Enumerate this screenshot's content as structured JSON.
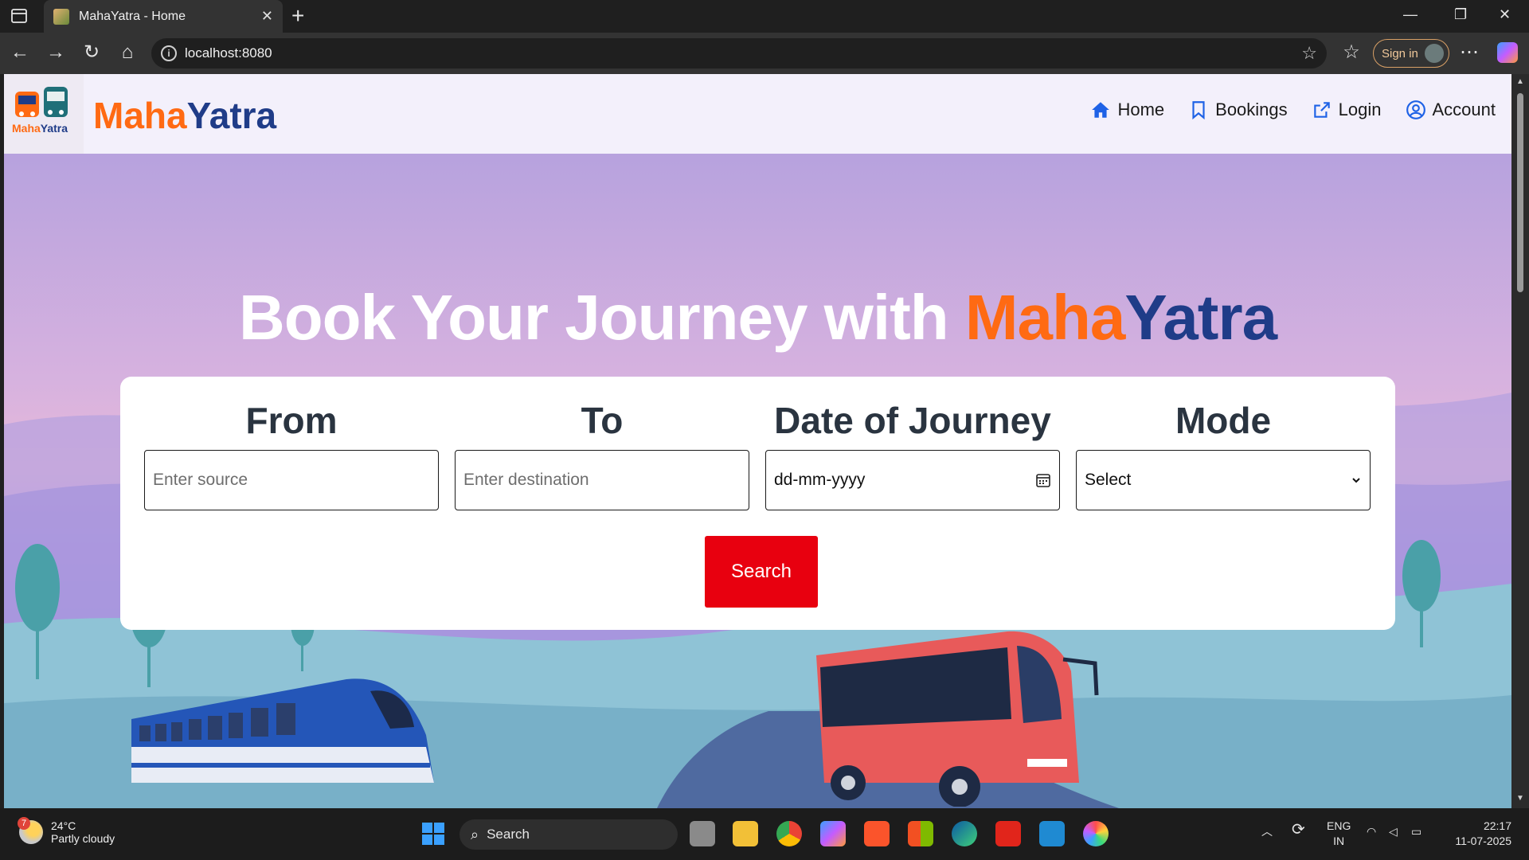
{
  "browser": {
    "tab_title": "MahaYatra - Home",
    "url": "localhost:8080",
    "signin_label": "Sign in"
  },
  "site": {
    "logo_text_maha": "Maha",
    "logo_text_yatra": "Yatra",
    "brand_maha": "Maha",
    "brand_yatra": "Yatra",
    "nav": [
      {
        "label": "Home",
        "icon": "home-icon"
      },
      {
        "label": "Bookings",
        "icon": "bookmark-icon"
      },
      {
        "label": "Login",
        "icon": "login-icon"
      },
      {
        "label": "Account",
        "icon": "account-icon"
      }
    ]
  },
  "hero": {
    "title_prefix": "Book Your Journey with ",
    "title_maha": "Maha",
    "title_yatra": "Yatra"
  },
  "search_form": {
    "from_label": "From",
    "from_placeholder": "Enter source",
    "to_label": "To",
    "to_placeholder": "Enter destination",
    "date_label": "Date of Journey",
    "date_value": "dd-mm-yyyy",
    "mode_label": "Mode",
    "mode_value": "Select",
    "search_label": "Search"
  },
  "colors": {
    "brand_orange": "#ff6a13",
    "brand_blue": "#1f3c88",
    "search_button": "#e8000f"
  },
  "taskbar": {
    "weather_temp": "24°C",
    "weather_desc": "Partly cloudy",
    "weather_badge": "7",
    "search_label": "Search",
    "lang_line1": "ENG",
    "lang_line2": "IN",
    "time": "22:17",
    "date": "11-07-2025"
  }
}
